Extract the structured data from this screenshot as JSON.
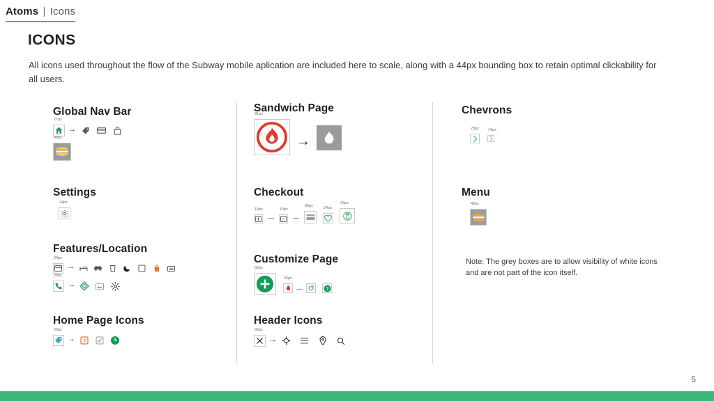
{
  "breadcrumb": {
    "parent": "Atoms",
    "separator": "|",
    "current": "Icons"
  },
  "page": {
    "title": "ICONS",
    "intro": "All icons used throughout the flow of the Subway mobile aplication are included here to scale, along with a 44px bounding box to retain optimal clickability for all users.",
    "number": "5",
    "accent_color": "#3cb878"
  },
  "note": "Note: The grey boxes are to allow visibility of white icons and are not part of the icon itself.",
  "groups": {
    "global_nav_bar": {
      "title": "Global Nav Bar",
      "row1": {
        "first_size": "27px",
        "icons": [
          "home-icon",
          "tag-icon",
          "wallet-icon",
          "bag-icon"
        ],
        "arrow": "→"
      },
      "row2": {
        "first_size": "48px",
        "icons": [
          "sandwich-yellow-icon"
        ]
      }
    },
    "settings": {
      "title": "Settings",
      "row1": {
        "first_size": "24px",
        "icons": [
          "gear-icon"
        ]
      }
    },
    "features_location": {
      "title": "Features/Location",
      "row1": {
        "first_size": "24px",
        "icons": [
          "card-icon",
          "bed-icon",
          "car-icon",
          "cup-icon",
          "moon-icon",
          "square-icon",
          "shopping-bag-icon",
          "tray-icon"
        ],
        "arrow": "→"
      },
      "row2": {
        "first_size": "28px",
        "icons": [
          "phone-icon",
          "diamond-icon",
          "image-icon",
          "sun-icon"
        ],
        "arrow": "→"
      }
    },
    "home_page_icons": {
      "title": "Home Page Icons",
      "row1": {
        "first_size": "26px",
        "icons": [
          "tag-blue-icon",
          "dollar-icon",
          "check-square-icon",
          "clock-green-icon"
        ],
        "arrow": "→"
      }
    },
    "sandwich_page": {
      "title": "Sandwich Page",
      "row1": {
        "first_size": "91px",
        "icons": [
          "flame-red-circle-icon",
          "flame-grey-circle-icon"
        ],
        "arrow": "→"
      }
    },
    "checkout": {
      "title": "Checkout",
      "row1": {
        "sizes": [
          "19px",
          "19px",
          "30px",
          "24px",
          "43px"
        ],
        "icons": [
          "plus-box-icon",
          "minus-box-icon",
          "card-pay-icon",
          "heart-icon",
          "trash-green-icon"
        ]
      }
    },
    "customize_page": {
      "title": "Customize Page",
      "row1": {
        "first_size": "58px",
        "second_size": "25px",
        "icons": [
          "plus-circle-green-icon",
          "flame-small-icon",
          "refresh-green-icon",
          "question-green-icon"
        ]
      }
    },
    "header_icons": {
      "title": "Header Icons",
      "row1": {
        "first_size": "30px",
        "icons": [
          "close-icon",
          "target-icon",
          "list-icon",
          "pin-icon",
          "search-icon"
        ],
        "arrow": "→"
      }
    },
    "chevrons": {
      "title": "Chevrons",
      "row1": {
        "sizes": [
          "23px",
          "14px"
        ],
        "icons": [
          "chevron-right-icon",
          "chevron-right-small-icon"
        ]
      }
    },
    "menu": {
      "title": "Menu",
      "row1": {
        "first_size": "46px",
        "icons": [
          "menu-sandwich-icon"
        ]
      }
    }
  }
}
